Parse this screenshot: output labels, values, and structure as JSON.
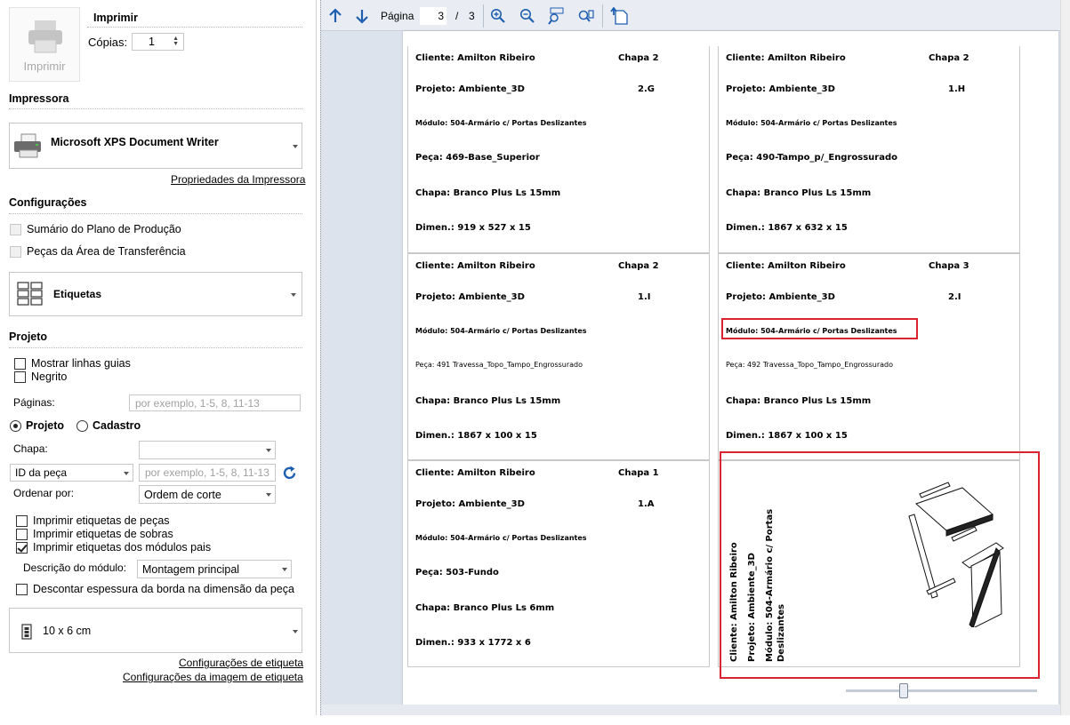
{
  "print": {
    "title": "Imprimir",
    "button_label": "Imprimir",
    "copies_label": "Cópias:",
    "copies_value": "1"
  },
  "printer": {
    "section": "Impressora",
    "name": "Microsoft XPS Document Writer",
    "properties_link": "Propriedades da Impressora"
  },
  "config": {
    "section": "Configurações",
    "summary": "Sumário do Plano de Produção",
    "transfer": "Peças da Área de Transferência",
    "report": "Etiquetas"
  },
  "project": {
    "section": "Projeto",
    "show_guides": "Mostrar linhas guias",
    "bold": "Negrito",
    "pages_label": "Páginas:",
    "pages_placeholder": "por exemplo, 1-5, 8, 11-13",
    "radio_project": "Projeto",
    "radio_register": "Cadastro",
    "sheet_label": "Chapa:",
    "sheet_value": "",
    "id_select": "ID da peça",
    "id_placeholder": "por exemplo, 1-5, 8, 11-13",
    "order_label": "Ordenar por:",
    "order_value": "Ordem de corte",
    "print_piece_labels": "Imprimir etiquetas de peças",
    "print_leftover_labels": "Imprimir etiquetas de sobras",
    "print_module_labels": "Imprimir etiquetas dos módulos pais",
    "module_desc_label": "Descrição do módulo:",
    "module_desc_value": "Montagem principal",
    "discount_border": "Descontar espessura da borda na dimensão da peça",
    "label_size": "10 x 6 cm",
    "label_settings_link": "Configurações de etiqueta",
    "label_image_settings_link": "Configurações da imagem de etiqueta"
  },
  "viewer": {
    "page_label": "Página",
    "page_current": "3",
    "page_sep": "/",
    "page_total": "3",
    "zoom_level": 0.3
  },
  "labels": [
    {
      "cliente": "Cliente: Amilton Ribeiro",
      "chapa": "Chapa 2",
      "projeto": "Projeto: Ambiente_3D",
      "code": "2.G",
      "modulo": "Módulo: 504-Armário c/ Portas Deslizantes",
      "peca": "Peça: 469-Base_Superior",
      "material": "Chapa: Branco Plus Ls 15mm",
      "dimen": "Dimen.: 919 x 527 x 15"
    },
    {
      "cliente": "Cliente: Amilton Ribeiro",
      "chapa": "Chapa 2",
      "projeto": "Projeto: Ambiente_3D",
      "code": "1.H",
      "modulo": "Módulo: 504-Armário c/ Portas Deslizantes",
      "peca": "Peça: 490-Tampo_p/_Engrossurado",
      "material": "Chapa: Branco Plus Ls 15mm",
      "dimen": "Dimen.: 1867 x 632 x 15"
    },
    {
      "cliente": "Cliente: Amilton Ribeiro",
      "chapa": "Chapa 2",
      "projeto": "Projeto: Ambiente_3D",
      "code": "1.I",
      "modulo": "Módulo: 504-Armário c/ Portas Deslizantes",
      "peca": "Peça: 491 Travessa_Topo_Tampo_Engrossurado",
      "material": "Chapa: Branco Plus Ls 15mm",
      "dimen": "Dimen.: 1867 x 100 x 15"
    },
    {
      "cliente": "Cliente: Amilton Ribeiro",
      "chapa": "Chapa 3",
      "projeto": "Projeto: Ambiente_3D",
      "code": "2.I",
      "modulo": "Módulo: 504-Armário c/ Portas Deslizantes",
      "peca": "Peça: 492 Travessa_Topo_Tampo_Engrossurado",
      "material": "Chapa: Branco Plus Ls 15mm",
      "dimen": "Dimen.: 1867 x 100 x 15"
    },
    {
      "cliente": "Cliente: Amilton Ribeiro",
      "chapa": "Chapa 1",
      "projeto": "Projeto: Ambiente_3D",
      "code": "1.A",
      "modulo": "Módulo: 504-Armário c/ Portas Deslizantes",
      "peca": "Peça: 503-Fundo",
      "material": "Chapa: Branco Plus Ls 6mm",
      "dimen": "Dimen.: 933 x 1772 x 6"
    }
  ],
  "module_label": {
    "cliente": "Cliente: Amilton Ribeiro",
    "projeto": "Projeto: Ambiente_3D",
    "modulo_1": "Módulo: 504-Armário c/ Portas",
    "modulo_2": "Deslizantes"
  },
  "colors": {
    "highlight": "#d9232e",
    "accent": "#1f5fb0",
    "preview_bg": "#dde3ec"
  }
}
